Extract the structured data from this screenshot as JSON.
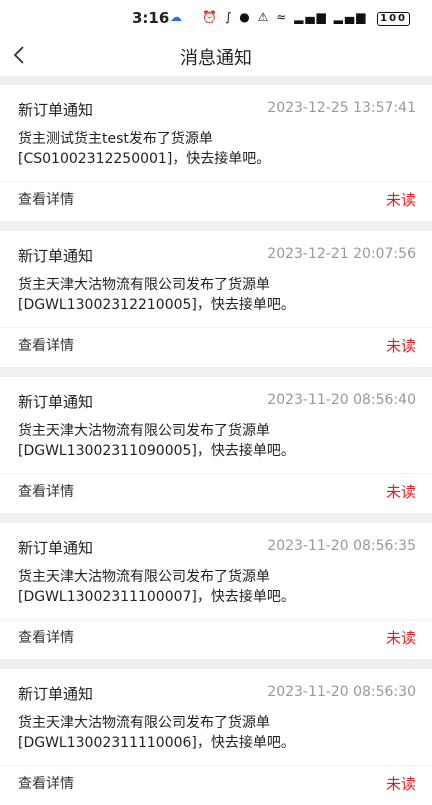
{
  "status_bar": {
    "time": "3:16",
    "battery": "100"
  },
  "header": {
    "title": "消息通知"
  },
  "messages": [
    {
      "title": "新订单通知",
      "time": "2023-12-25 13:57:41",
      "content_line1": "货主测试货主test发布了货源单",
      "content_line2": "[CS01002312250001]，快去接单吧。",
      "detail_label": "查看详情",
      "status": "未读"
    },
    {
      "title": "新订单通知",
      "time": "2023-12-21 20:07:56",
      "content_line1": "货主天津大沽物流有限公司发布了货源单",
      "content_line2": "[DGWL13002312210005]，快去接单吧。",
      "detail_label": "查看详情",
      "status": "未读"
    },
    {
      "title": "新订单通知",
      "time": "2023-11-20 08:56:40",
      "content_line1": "货主天津大沽物流有限公司发布了货源单",
      "content_line2": "[DGWL13002311090005]，快去接单吧。",
      "detail_label": "查看详情",
      "status": "未读"
    },
    {
      "title": "新订单通知",
      "time": "2023-11-20 08:56:35",
      "content_line1": "货主天津大沽物流有限公司发布了货源单",
      "content_line2": "[DGWL13002311100007]，快去接单吧。",
      "detail_label": "查看详情",
      "status": "未读"
    },
    {
      "title": "新订单通知",
      "time": "2023-11-20 08:56:30",
      "content_line1": "货主天津大沽物流有限公司发布了货源单",
      "content_line2": "[DGWL13002311110006]，快去接单吧。",
      "detail_label": "查看详情",
      "status": "未读"
    }
  ]
}
